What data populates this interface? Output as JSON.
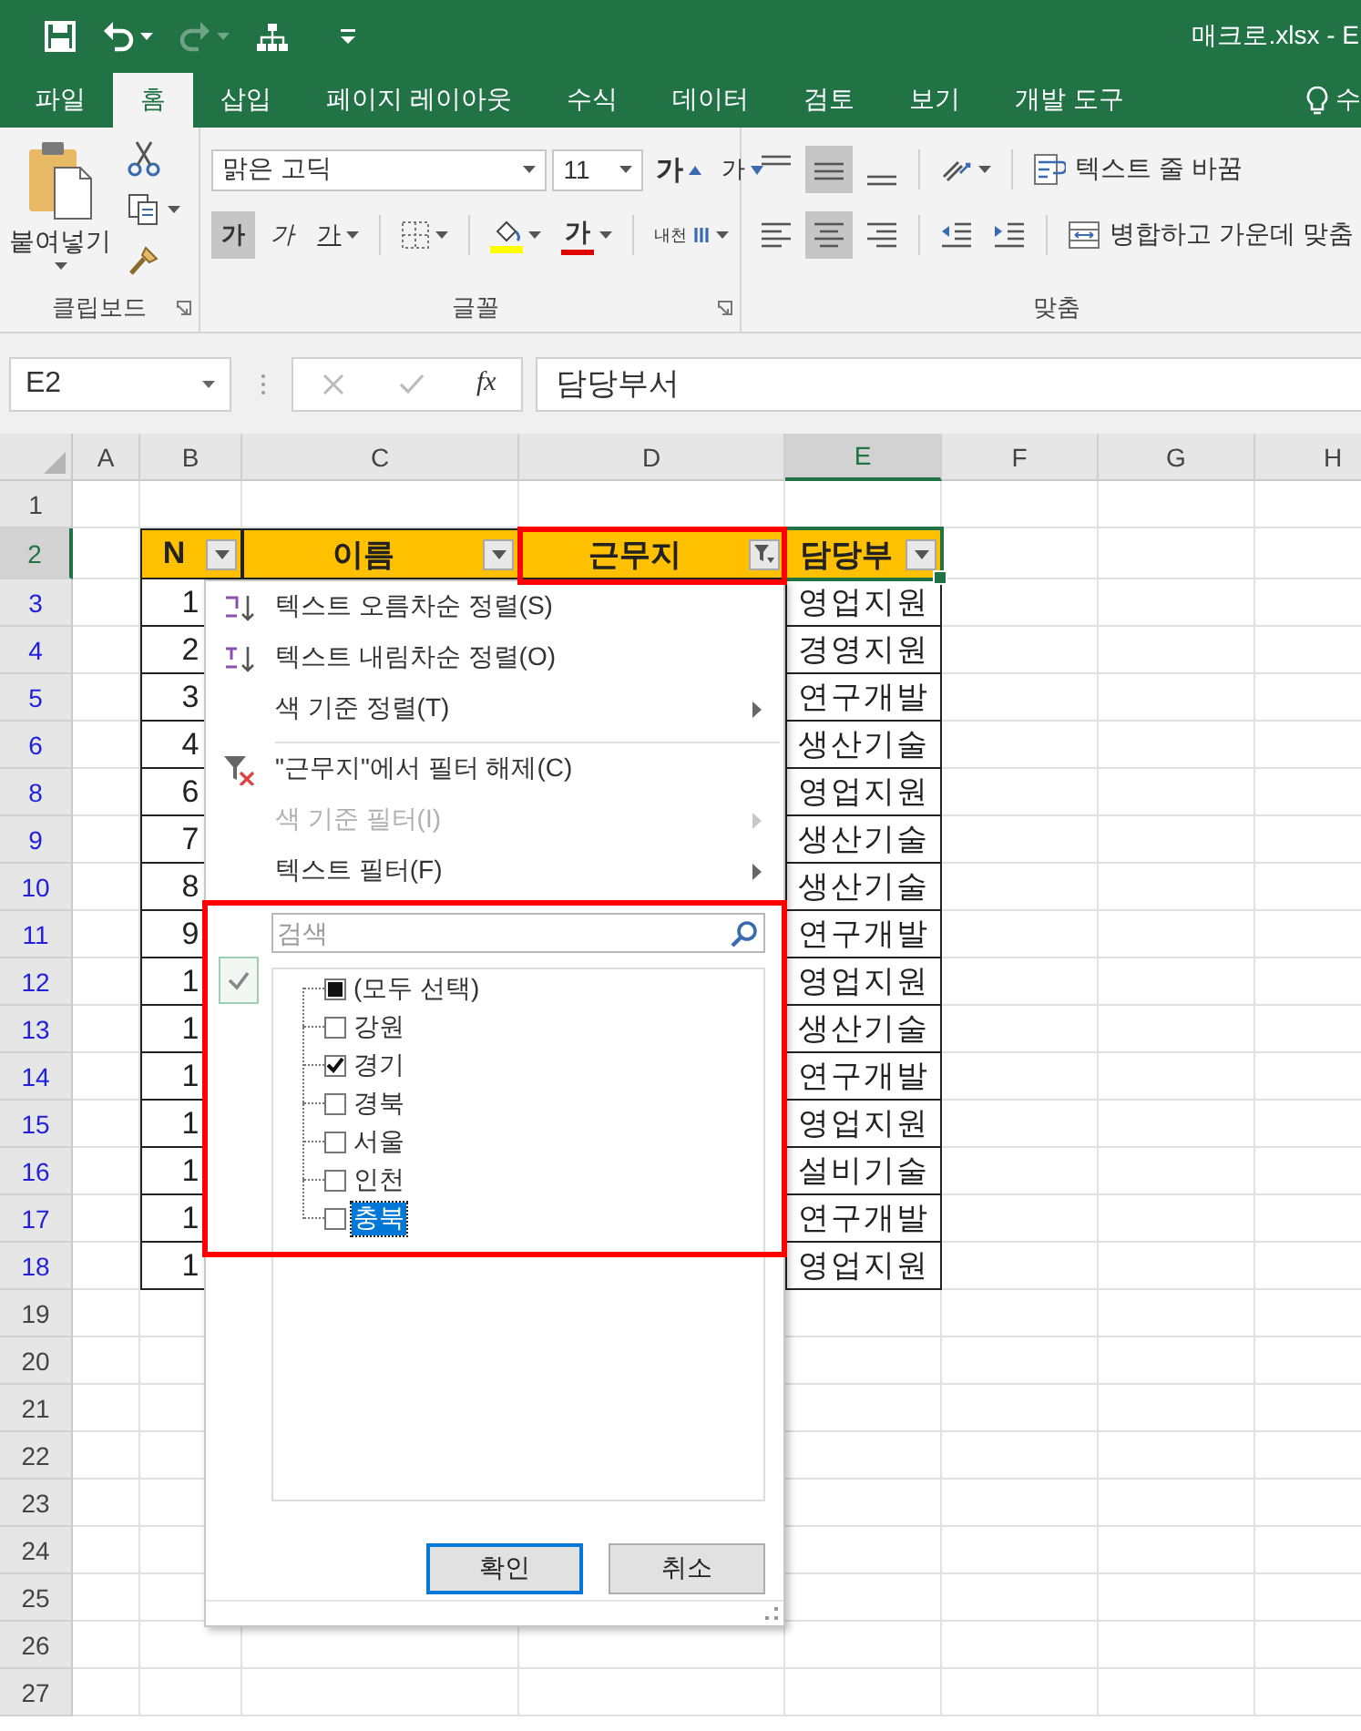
{
  "title_bar": {
    "title": "매크로.xlsx - E",
    "quick_access": [
      {
        "kind": "save",
        "disabled": false
      },
      {
        "kind": "undo",
        "disabled": false
      },
      {
        "kind": "redo",
        "disabled": true
      },
      {
        "kind": "tree",
        "disabled": false
      },
      {
        "kind": "customize",
        "disabled": false
      }
    ]
  },
  "ribbon_tabs": [
    {
      "label": "파일",
      "selected": false
    },
    {
      "label": "홈",
      "selected": true
    },
    {
      "label": "삽입",
      "selected": false
    },
    {
      "label": "페이지 레이아웃",
      "selected": false
    },
    {
      "label": "수식",
      "selected": false
    },
    {
      "label": "데이터",
      "selected": false
    },
    {
      "label": "검토",
      "selected": false
    },
    {
      "label": "보기",
      "selected": false
    },
    {
      "label": "개발 도구",
      "selected": false
    }
  ],
  "tell_me": {
    "label": "수"
  },
  "clipboard": {
    "label": "클립보드",
    "paste": "붙여넣기"
  },
  "font": {
    "label": "글꼴",
    "font_name": "맑은 고딕",
    "font_size": "11",
    "grow": "가",
    "shrink": "가",
    "styles": [
      {
        "kind": "bold",
        "text": "가",
        "selected": true
      },
      {
        "kind": "italic",
        "text": "가",
        "selected": false
      },
      {
        "kind": "underline",
        "text": "가",
        "selected": false
      }
    ],
    "font_color": "가",
    "phonetic": "내천"
  },
  "alignment": {
    "label": "맞춤",
    "vertical": [
      {
        "kind": "top",
        "selected": false
      },
      {
        "kind": "middle",
        "selected": true
      },
      {
        "kind": "bottom",
        "selected": false
      }
    ],
    "horizontal": [
      {
        "kind": "left",
        "selected": false
      },
      {
        "kind": "center",
        "selected": true
      },
      {
        "kind": "right",
        "selected": false
      }
    ],
    "wrap_text": "텍스트 줄 바꿈",
    "merge_center": "병합하고 가운데 맞춤"
  },
  "formula_bar": {
    "name_box": "E2",
    "function": "fx",
    "value": "담당부서"
  },
  "sheet": {
    "columns": [
      {
        "label": "A",
        "selected": false
      },
      {
        "label": "B",
        "selected": false
      },
      {
        "label": "C",
        "selected": false
      },
      {
        "label": "D",
        "selected": false
      },
      {
        "label": "E",
        "selected": true
      },
      {
        "label": "F",
        "selected": false
      },
      {
        "label": "G",
        "selected": false
      },
      {
        "label": "H",
        "selected": false
      }
    ],
    "rows": [
      {
        "label": "1",
        "filtered": false,
        "selected": false
      },
      {
        "label": "2",
        "filtered": false,
        "selected": true
      },
      {
        "label": "3",
        "filtered": true,
        "selected": false
      },
      {
        "label": "4",
        "filtered": true,
        "selected": false
      },
      {
        "label": "5",
        "filtered": true,
        "selected": false
      },
      {
        "label": "6",
        "filtered": true,
        "selected": false
      },
      {
        "label": "8",
        "filtered": true,
        "selected": false
      },
      {
        "label": "9",
        "filtered": true,
        "selected": false
      },
      {
        "label": "10",
        "filtered": true,
        "selected": false
      },
      {
        "label": "11",
        "filtered": true,
        "selected": false
      },
      {
        "label": "12",
        "filtered": true,
        "selected": false
      },
      {
        "label": "13",
        "filtered": true,
        "selected": false
      },
      {
        "label": "14",
        "filtered": true,
        "selected": false
      },
      {
        "label": "15",
        "filtered": true,
        "selected": false
      },
      {
        "label": "16",
        "filtered": true,
        "selected": false
      },
      {
        "label": "17",
        "filtered": true,
        "selected": false
      },
      {
        "label": "18",
        "filtered": true,
        "selected": false
      },
      {
        "label": "19",
        "filtered": false,
        "selected": false
      },
      {
        "label": "20",
        "filtered": false,
        "selected": false
      },
      {
        "label": "21",
        "filtered": false,
        "selected": false
      },
      {
        "label": "22",
        "filtered": false,
        "selected": false
      },
      {
        "label": "23",
        "filtered": false,
        "selected": false
      },
      {
        "label": "24",
        "filtered": false,
        "selected": false
      },
      {
        "label": "25",
        "filtered": false,
        "selected": false
      },
      {
        "label": "26",
        "filtered": false,
        "selected": false
      },
      {
        "label": "27",
        "filtered": false,
        "selected": false
      }
    ]
  },
  "table": {
    "headers": [
      {
        "text": "N",
        "filtered": false,
        "active": false
      },
      {
        "text": "이름",
        "filtered": false,
        "active": false
      },
      {
        "text": "근무지",
        "filtered": true,
        "active": false
      },
      {
        "text": "담당부",
        "filtered": false,
        "active": true
      }
    ],
    "rows": [
      {
        "no": "1",
        "dept": "영업지원"
      },
      {
        "no": "2",
        "dept": "경영지원"
      },
      {
        "no": "3",
        "dept": "연구개발"
      },
      {
        "no": "4",
        "dept": "생산기술"
      },
      {
        "no": "6",
        "dept": "영업지원"
      },
      {
        "no": "7",
        "dept": "생산기술"
      },
      {
        "no": "8",
        "dept": "생산기술"
      },
      {
        "no": "9",
        "dept": "연구개발"
      },
      {
        "no": "1",
        "dept": "영업지원"
      },
      {
        "no": "1",
        "dept": "생산기술"
      },
      {
        "no": "1",
        "dept": "연구개발"
      },
      {
        "no": "1",
        "dept": "영업지원"
      },
      {
        "no": "1",
        "dept": "설비기술"
      },
      {
        "no": "1",
        "dept": "연구개발"
      },
      {
        "no": "1",
        "dept": "영업지원"
      }
    ]
  },
  "filter_menu": {
    "items": [
      {
        "kind": "sort_asc",
        "label": "텍스트 오름차순 정렬(S)",
        "disabled": false,
        "submenu": false
      },
      {
        "kind": "sort_desc",
        "label": "텍스트 내림차순 정렬(O)",
        "disabled": false,
        "submenu": false
      },
      {
        "kind": "plain",
        "label": "색 기준 정렬(T)",
        "disabled": false,
        "submenu": true
      },
      {
        "kind": "separator"
      },
      {
        "kind": "clear_filter",
        "label": "\"근무지\"에서 필터 해제(C)",
        "disabled": false,
        "submenu": false
      },
      {
        "kind": "plain",
        "label": "색 기준 필터(I)",
        "disabled": true,
        "submenu": true
      },
      {
        "kind": "plain",
        "label": "텍스트 필터(F)",
        "disabled": false,
        "submenu": true
      },
      {
        "kind": "separator"
      }
    ],
    "search": {
      "placeholder": "검색"
    },
    "values": [
      {
        "label": "(모두 선택)",
        "checked": false,
        "partial": true,
        "selected": false
      },
      {
        "label": "강원",
        "checked": false,
        "partial": false,
        "selected": false
      },
      {
        "label": "경기",
        "checked": true,
        "partial": false,
        "selected": false
      },
      {
        "label": "경북",
        "checked": false,
        "partial": false,
        "selected": false
      },
      {
        "label": "서울",
        "checked": false,
        "partial": false,
        "selected": false
      },
      {
        "label": "인천",
        "checked": false,
        "partial": false,
        "selected": false
      },
      {
        "label": "충북",
        "checked": false,
        "partial": false,
        "selected": true
      }
    ],
    "buttons": [
      {
        "label": "확인",
        "focused": true
      },
      {
        "label": "취소",
        "focused": false
      }
    ]
  },
  "highlights": {
    "filter_header": true,
    "value_list": true
  }
}
